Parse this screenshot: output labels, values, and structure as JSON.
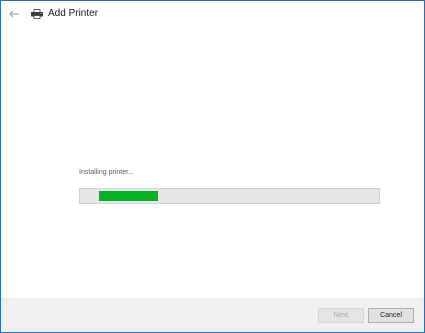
{
  "window": {
    "title": "Add Printer",
    "accent_color": "#2b6cc4"
  },
  "titlebar": {
    "back_icon": "arrow-left-icon",
    "app_icon": "printer-icon"
  },
  "install": {
    "status_text": "Installing printer...",
    "progress_fraction": 0.2,
    "progress_color": "#06b025"
  },
  "footer": {
    "next_label": "Next",
    "next_enabled": false,
    "cancel_label": "Cancel"
  }
}
